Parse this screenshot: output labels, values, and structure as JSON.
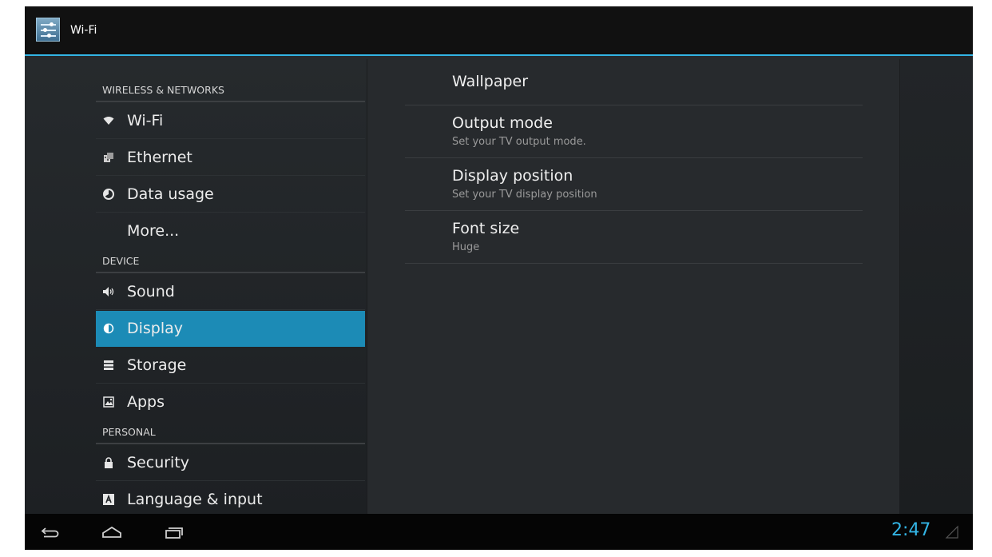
{
  "action_bar": {
    "title": "Wi-Fi",
    "icon": "settings-sliders-icon"
  },
  "sidebar": {
    "sections": [
      {
        "header": "WIRELESS & NETWORKS",
        "items": [
          {
            "label": "Wi-Fi",
            "icon": "wifi-icon"
          },
          {
            "label": "Ethernet",
            "icon": "ethernet-icon"
          },
          {
            "label": "Data usage",
            "icon": "data-usage-icon"
          },
          {
            "label": "More...",
            "icon": ""
          }
        ]
      },
      {
        "header": "DEVICE",
        "items": [
          {
            "label": "Sound",
            "icon": "speaker-icon"
          },
          {
            "label": "Display",
            "icon": "brightness-icon",
            "selected": true
          },
          {
            "label": "Storage",
            "icon": "storage-icon"
          },
          {
            "label": "Apps",
            "icon": "apps-icon"
          }
        ]
      },
      {
        "header": "PERSONAL",
        "items": [
          {
            "label": "Security",
            "icon": "lock-icon"
          },
          {
            "label": "Language & input",
            "icon": "keyboard-a-icon"
          }
        ]
      }
    ]
  },
  "detail": {
    "prefs": [
      {
        "title": "Wallpaper",
        "summary": ""
      },
      {
        "title": "Output mode",
        "summary": "Set your TV output mode."
      },
      {
        "title": "Display position",
        "summary": "Set your TV display position"
      },
      {
        "title": "Font size",
        "summary": "Huge"
      }
    ]
  },
  "status": {
    "time": "2:47"
  },
  "colors": {
    "accent": "#33b5e5",
    "selected": "#1c8bb6",
    "background": "#0d0d0d"
  }
}
